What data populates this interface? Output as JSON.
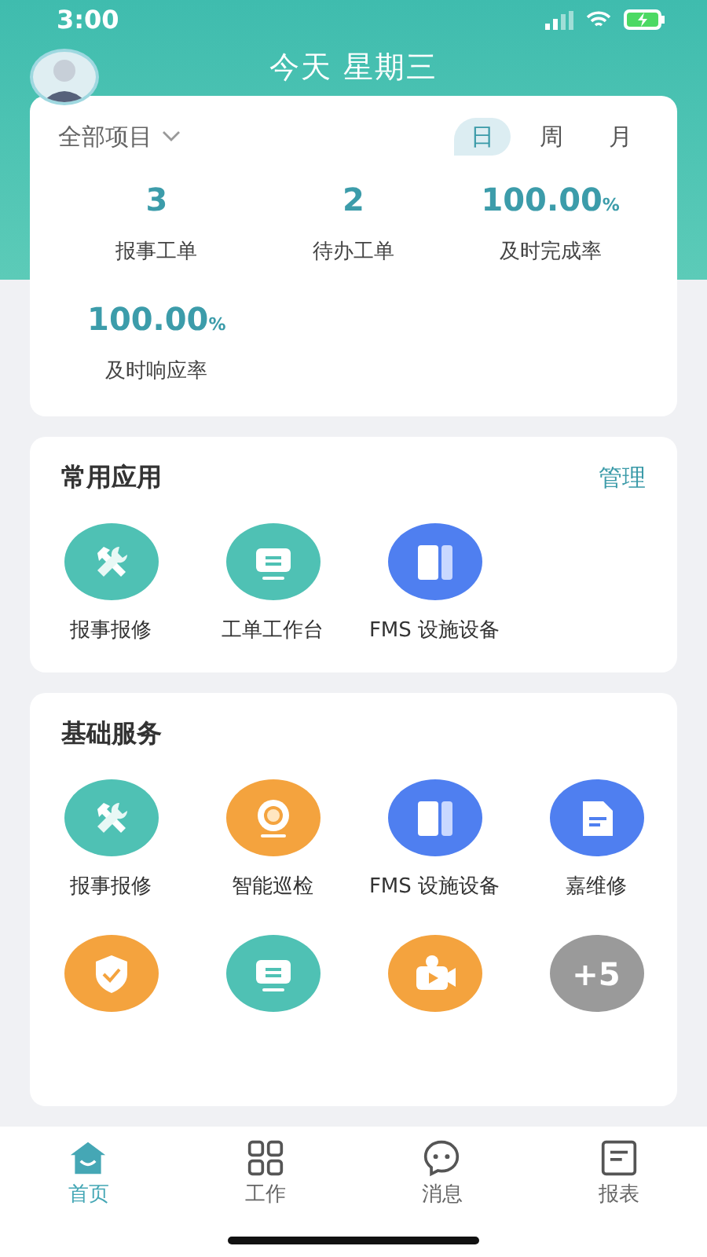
{
  "status_bar": {
    "time": "3:00"
  },
  "header": {
    "title": "今天 星期三"
  },
  "summary": {
    "project_filter": "全部项目",
    "periods": [
      {
        "label": "日",
        "selected": true
      },
      {
        "label": "周",
        "selected": false
      },
      {
        "label": "月",
        "selected": false
      }
    ],
    "stats": [
      {
        "value": "3",
        "label": "报事工单"
      },
      {
        "value": "2",
        "label": "待办工单"
      },
      {
        "value": "100.00",
        "unit": "%",
        "label": "及时完成率"
      },
      {
        "value": "100.00",
        "unit": "%",
        "label": "及时响应率"
      }
    ]
  },
  "common_apps": {
    "title": "常用应用",
    "action": "管理",
    "apps": [
      {
        "kind": "tools",
        "label": "报事报修",
        "color": "#4fc1b4"
      },
      {
        "kind": "monitor",
        "label": "工单工作台",
        "color": "#4fc1b4"
      },
      {
        "kind": "device",
        "label": "FMS 设施设备",
        "color": "#4f7ff0"
      }
    ]
  },
  "basic_services": {
    "title": "基础服务",
    "apps": [
      {
        "kind": "tools",
        "label": "报事报修",
        "color": "#4fc1b4"
      },
      {
        "kind": "camera",
        "label": "智能巡检",
        "color": "#f4a33e"
      },
      {
        "kind": "device",
        "label": "FMS 设施设备",
        "color": "#4f7ff0"
      },
      {
        "kind": "document",
        "label": "嘉维修",
        "color": "#4f7ff0"
      },
      {
        "kind": "shield",
        "color": "#f4a33e"
      },
      {
        "kind": "monitor",
        "color": "#4fc1b4"
      },
      {
        "kind": "video",
        "color": "#f4a33e"
      },
      {
        "kind": "more",
        "badge": "+5",
        "color": "#9a9a9a"
      }
    ]
  },
  "tab_bar": [
    {
      "kind": "home",
      "label": "首页",
      "selected": true
    },
    {
      "kind": "grid",
      "label": "工作",
      "selected": false
    },
    {
      "kind": "chat",
      "label": "消息",
      "selected": false
    },
    {
      "kind": "report",
      "label": "报表",
      "selected": false
    }
  ]
}
